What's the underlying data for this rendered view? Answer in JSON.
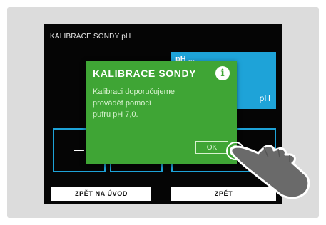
{
  "screen": {
    "title": "KALIBRACE SONDY pH",
    "blue_panel_top": "pH ...",
    "blue_panel_unit": "pH",
    "minus_symbol": "—"
  },
  "dialog": {
    "title": "KALIBRACE SONDY",
    "info_symbol": "i",
    "body_lines": [
      "Kalibraci doporučujeme",
      "provádět pomocí",
      "pufru pH 7,0."
    ],
    "ok_label": "OK"
  },
  "buttons": {
    "home_label": "ZPĚT NA ÚVOD",
    "back_label": "ZPĚT"
  },
  "colors": {
    "dialog_green": "#3fa535",
    "accent_blue": "#1ea3d8",
    "screen_black": "#050505",
    "frame_gray": "#dcdcdc"
  },
  "icons": {
    "info": "info-icon",
    "hand": "pointing-hand-icon"
  }
}
